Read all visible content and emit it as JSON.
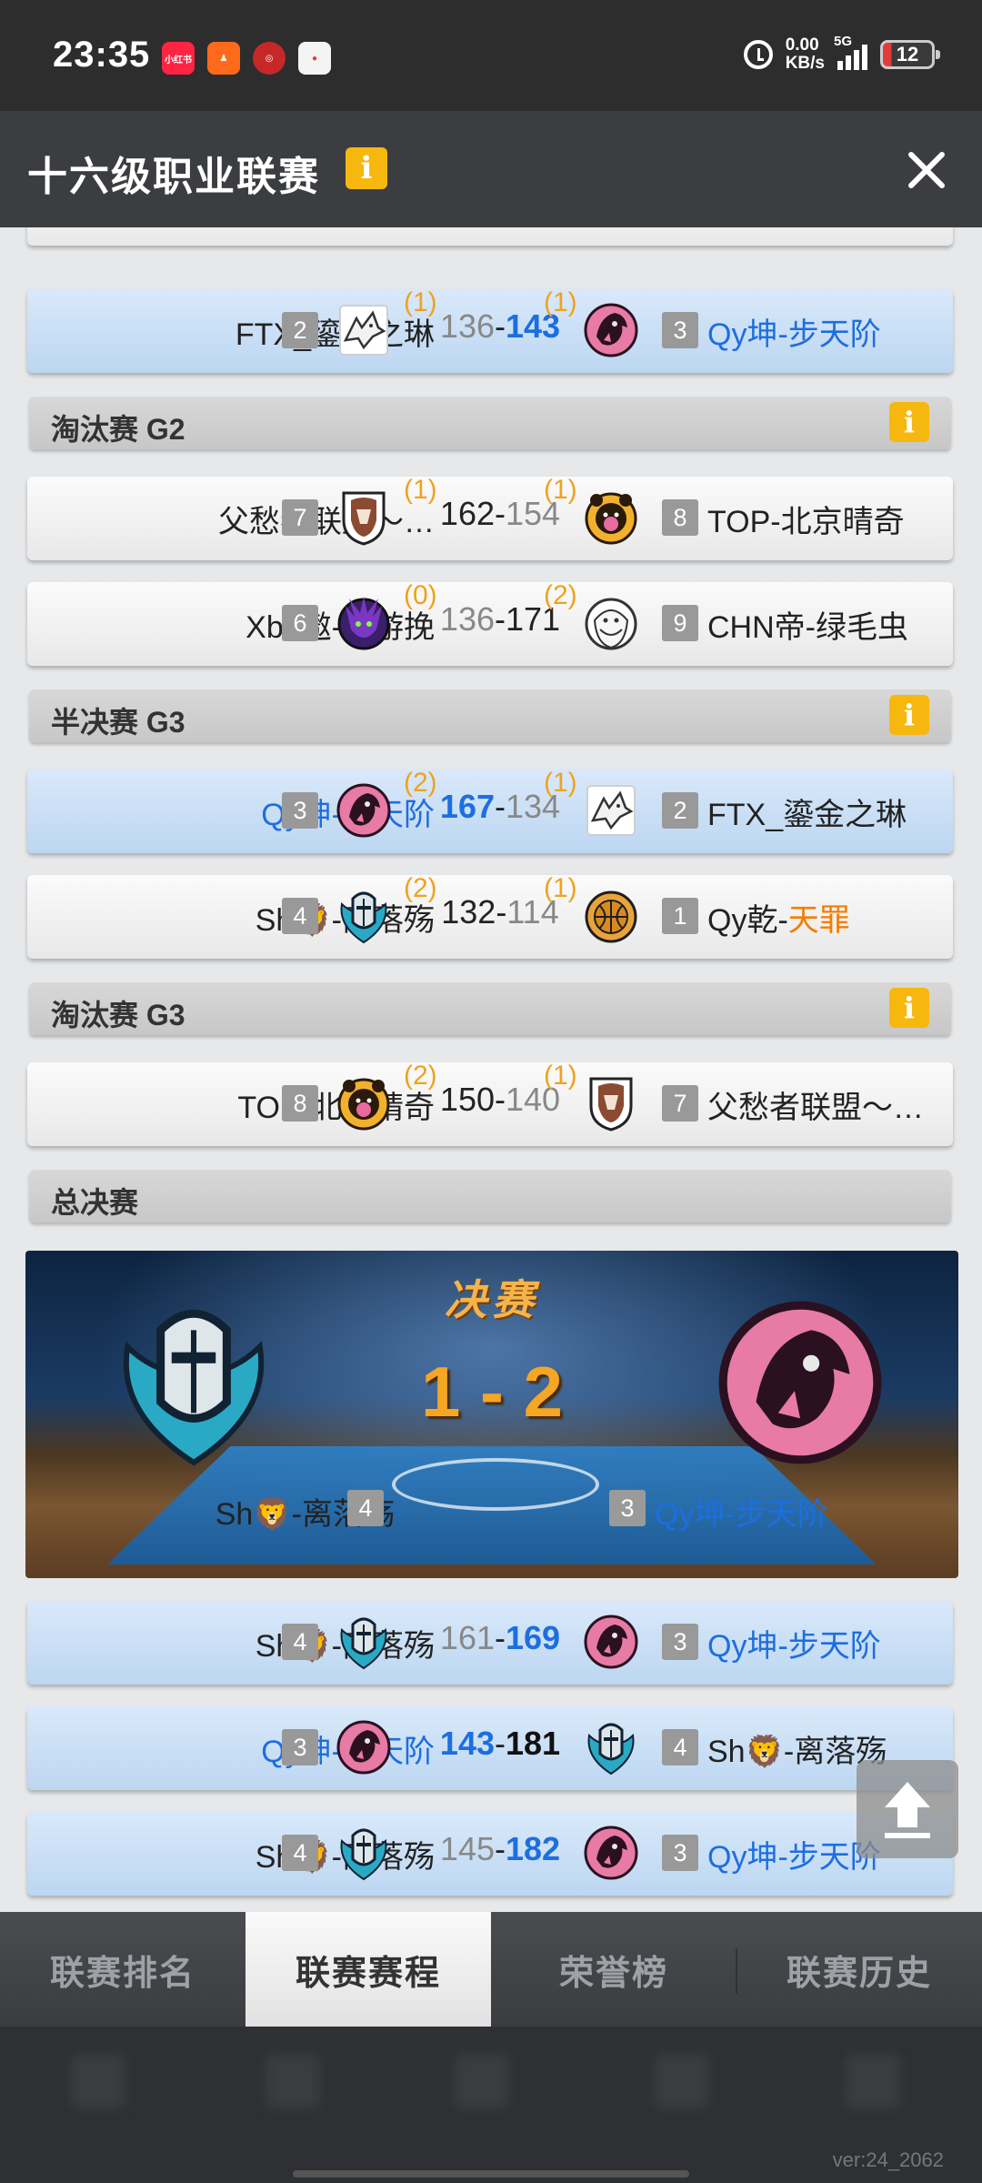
{
  "status_bar": {
    "time": "23:35",
    "apps": [
      {
        "name": "xiaohongshu-icon",
        "label": "小红书",
        "color": "#ff2442"
      },
      {
        "name": "taobao-icon",
        "label": "",
        "color": "#ff6a1a"
      },
      {
        "name": "bank-icon",
        "label": "",
        "color": "#d42d2d"
      },
      {
        "name": "map-pin-app-icon",
        "label": "",
        "color": "#e84b4b"
      }
    ],
    "net_speed_value": "0.00",
    "net_speed_unit": "KB/s",
    "network": "5G",
    "battery": "12"
  },
  "header": {
    "title": "十六级职业联赛",
    "info": "i"
  },
  "colors": {
    "accent_blue": "#1d6ee0",
    "wins_orange": "#f0a21e",
    "info_yellow": "#f6b80f",
    "tianzui_orange": "#f57c00"
  },
  "rows_top": [
    {
      "left": "FTX_鎏金之琳",
      "left_seed": "2",
      "left_wins": "(1)",
      "left_score": "136",
      "right_score": "143",
      "right_wins": "(1)",
      "right_seed": "3",
      "right": "Qy坤-步天阶",
      "winner": "right"
    }
  ],
  "sections": {
    "knockout_g2": "淘汰赛 G2",
    "semi_g3": "半决赛 G3",
    "knockout_g3": "淘汰赛 G3",
    "final": "总决赛"
  },
  "knockout_g2": [
    {
      "left": "父愁者联盟～…",
      "left_seed": "7",
      "left_wins": "(1)",
      "left_score": "162",
      "right_score": "154",
      "right_wins": "(1)",
      "right_seed": "8",
      "right": "TOP-北京晴奇"
    },
    {
      "left": "Xba遨-遨游挽",
      "left_seed": "6",
      "left_wins": "(0)",
      "left_score": "136",
      "right_score": "171",
      "right_wins": "(2)",
      "right_seed": "9",
      "right": "CHN帝-绿毛虫"
    }
  ],
  "semi_g3": [
    {
      "left": "Qy坤-步天阶",
      "left_seed": "3",
      "left_wins": "(2)",
      "left_score": "167",
      "right_score": "134",
      "right_wins": "(1)",
      "right_seed": "2",
      "right": "FTX_鎏金之琳"
    },
    {
      "left": "Sh🦁-离落殇",
      "left_seed": "4",
      "left_wins": "(2)",
      "left_score": "132",
      "right_score": "114",
      "right_wins": "(1)",
      "right_seed": "1",
      "right_a": "Qy乾-",
      "right_b": "天罪"
    }
  ],
  "knockout_g3": [
    {
      "left": "TOP-北京晴奇",
      "left_seed": "8",
      "left_wins": "(2)",
      "left_score": "150",
      "right_score": "140",
      "right_wins": "(1)",
      "right_seed": "7",
      "right": "父愁者联盟～…"
    }
  ],
  "final": {
    "banner_title": "决赛",
    "series_score": "1 - 2",
    "left_team": "Sh🦁-离落殇",
    "left_seed": "4",
    "right_team": "Qy坤-步天阶",
    "right_seed": "3",
    "games": [
      {
        "left": "Sh🦁-离落殇",
        "left_seed": "4",
        "left_score": "161",
        "right_score": "169",
        "right_seed": "3",
        "right": "Qy坤-步天阶"
      },
      {
        "left": "Qy坤-步天阶",
        "left_seed": "3",
        "left_score": "143",
        "right_score": "181",
        "right_seed": "4",
        "right": "Sh🦁-离落殇"
      },
      {
        "left": "Sh🦁-离落殇",
        "left_seed": "4",
        "left_score": "145",
        "right_score": "182",
        "right_seed": "3",
        "right": "Qy坤-步天阶"
      }
    ]
  },
  "tabs": [
    {
      "label": "联赛排名",
      "active": false
    },
    {
      "label": "联赛赛程",
      "active": true
    },
    {
      "label": "荣誉榜",
      "active": false
    },
    {
      "label": "联赛历史",
      "active": false
    }
  ],
  "version": "ver:24_2062"
}
